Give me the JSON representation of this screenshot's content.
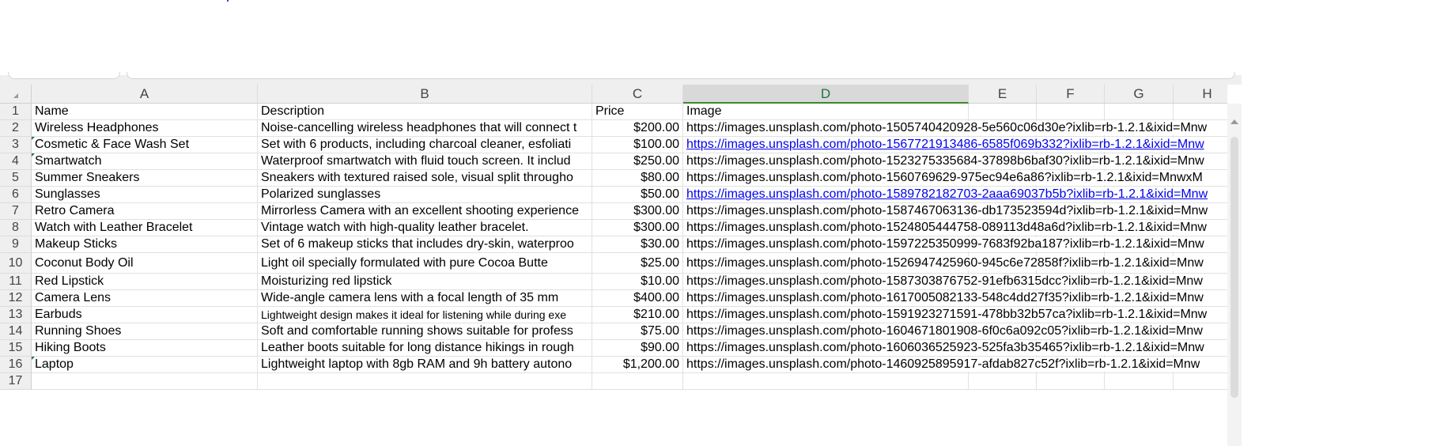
{
  "columns": [
    "A",
    "B",
    "C",
    "D",
    "E",
    "F",
    "G",
    "H"
  ],
  "selected_column": "D",
  "header_row": {
    "name": "Name",
    "description": "Description",
    "price": "Price",
    "image": "Image"
  },
  "rows": [
    {
      "n": "2",
      "name": "Wireless Headphones",
      "description": "Noise-cancelling wireless headphones that will connect t",
      "price": "$200.00",
      "image": "https://images.unsplash.com/photo-1505740420928-5e560c06d30e?ixlib=rb-1.2.1&ixid=Mnw",
      "link": false
    },
    {
      "n": "3",
      "name": "Cosmetic & Face Wash Set",
      "description": "Set with 6 products, including charcoal cleaner, esfoliati",
      "price": "$100.00",
      "image": "https://images.unsplash.com/photo-1567721913486-6585f069b332?ixlib=rb-1.2.1&ixid=Mnw",
      "link": true
    },
    {
      "n": "4",
      "name": "Smartwatch",
      "description": "Waterproof smartwatch with fluid touch screen. It includ",
      "price": "$250.00",
      "image": "https://images.unsplash.com/photo-1523275335684-37898b6baf30?ixlib=rb-1.2.1&ixid=Mnw",
      "link": false
    },
    {
      "n": "5",
      "name": "Summer Sneakers",
      "description": "Sneakers with textured raised sole, visual split througho",
      "price": "$80.00",
      "image": "https://images.unsplash.com/photo-1560769629-975ec94e6a86?ixlib=rb-1.2.1&ixid=MnwxM",
      "link": false
    },
    {
      "n": "6",
      "name": "Sunglasses",
      "description": "Polarized sunglasses",
      "price": "$50.00",
      "image": "https://images.unsplash.com/photo-1589782182703-2aaa69037b5b?ixlib=rb-1.2.1&ixid=Mnw",
      "link": true
    },
    {
      "n": "7",
      "name": "Retro Camera",
      "description": "Mirrorless Camera with an excellent shooting experience",
      "price": "$300.00",
      "image": "https://images.unsplash.com/photo-1587467063136-db173523594d?ixlib=rb-1.2.1&ixid=Mnw",
      "link": false
    },
    {
      "n": "8",
      "name": "Watch with Leather Bracelet",
      "description": "Vintage watch with high-quality leather bracelet.",
      "price": "$300.00",
      "image": "https://images.unsplash.com/photo-1524805444758-089113d48a6d?ixlib=rb-1.2.1&ixid=Mnw",
      "link": false
    },
    {
      "n": "9",
      "name": "Makeup Sticks",
      "description": "Set of 6 makeup sticks that includes dry-skin, waterproo",
      "price": "$30.00",
      "image": "https://images.unsplash.com/photo-1597225350999-7683f92ba187?ixlib=rb-1.2.1&ixid=Mnw",
      "link": false
    },
    {
      "n": "10",
      "name": "Coconut Body Oil",
      "description": "Light oil specially formulated with pure Cocoa Butte",
      "price": "$25.00",
      "image": "https://images.unsplash.com/photo-1526947425960-945c6e72858f?ixlib=rb-1.2.1&ixid=Mnw",
      "link": false
    },
    {
      "n": "11",
      "name": "Red Lipstick",
      "description": "Moisturizing red lipstick",
      "price": "$10.00",
      "image": "https://images.unsplash.com/photo-1587303876752-91efb6315dcc?ixlib=rb-1.2.1&ixid=Mnw",
      "link": false
    },
    {
      "n": "12",
      "name": "Camera Lens",
      "description": "Wide-angle camera lens with a focal length of 35 mm",
      "price": "$400.00",
      "image": "https://images.unsplash.com/photo-1617005082133-548c4dd27f35?ixlib=rb-1.2.1&ixid=Mnw",
      "link": false
    },
    {
      "n": "13",
      "name": "Earbuds",
      "description": "Lightweight design makes it ideal for listening while during exe",
      "price": "$210.00",
      "image": "https://images.unsplash.com/photo-1591923271591-478bb32b57ca?ixlib=rb-1.2.1&ixid=Mnw",
      "link": false
    },
    {
      "n": "14",
      "name": "Running Shoes",
      "description": "Soft and comfortable running shows suitable for profess",
      "price": "$75.00",
      "image": "https://images.unsplash.com/photo-1604671801908-6f0c6a092c05?ixlib=rb-1.2.1&ixid=Mnw",
      "link": false
    },
    {
      "n": "15",
      "name": "Hiking Boots",
      "description": "Leather boots suitable for long distance hikings in rough",
      "price": "$90.00",
      "image": "https://images.unsplash.com/photo-1606036525923-525fa3b35465?ixlib=rb-1.2.1&ixid=Mnw",
      "link": false
    },
    {
      "n": "16",
      "name": "Laptop",
      "description": "Lightweight laptop with 8gb RAM and 9h battery autono",
      "price": "$1,200.00",
      "image": "https://images.unsplash.com/photo-1460925895917-afdab827c52f?ixlib=rb-1.2.1&ixid=Mnw",
      "link": false
    }
  ],
  "empty_row": "17"
}
